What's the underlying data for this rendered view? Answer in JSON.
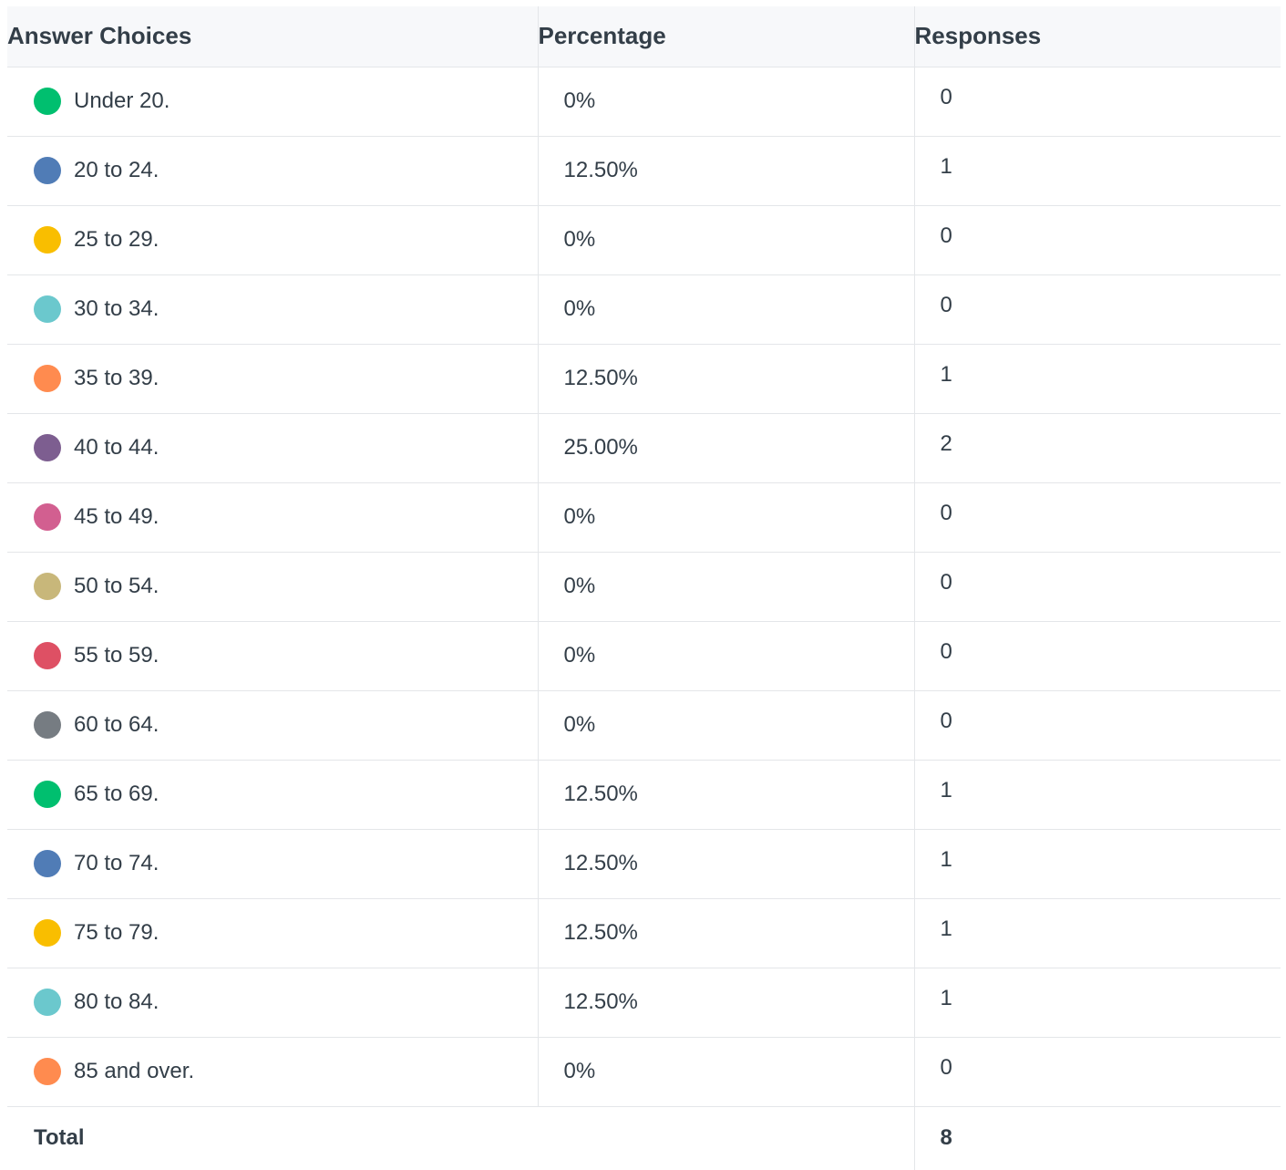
{
  "chart_data": {
    "type": "table",
    "columns": [
      "Answer Choices",
      "Percentage",
      "Responses"
    ],
    "rows": [
      {
        "label": "Under 20.",
        "percentage": "0%",
        "responses": "0",
        "color": "#00bf6f"
      },
      {
        "label": "20 to 24.",
        "percentage": "12.50%",
        "responses": "1",
        "color": "#507cb6"
      },
      {
        "label": "25 to 29.",
        "percentage": "0%",
        "responses": "0",
        "color": "#f9be00"
      },
      {
        "label": "30 to 34.",
        "percentage": "0%",
        "responses": "0",
        "color": "#6bc8cd"
      },
      {
        "label": "35 to 39.",
        "percentage": "12.50%",
        "responses": "1",
        "color": "#ff8b4f"
      },
      {
        "label": "40 to 44.",
        "percentage": "25.00%",
        "responses": "2",
        "color": "#7d5e90"
      },
      {
        "label": "45 to 49.",
        "percentage": "0%",
        "responses": "0",
        "color": "#d25f90"
      },
      {
        "label": "50 to 54.",
        "percentage": "0%",
        "responses": "0",
        "color": "#c8b77a"
      },
      {
        "label": "55 to 59.",
        "percentage": "0%",
        "responses": "0",
        "color": "#de5064"
      },
      {
        "label": "60 to 64.",
        "percentage": "0%",
        "responses": "0",
        "color": "#767c82"
      },
      {
        "label": "65 to 69.",
        "percentage": "12.50%",
        "responses": "1",
        "color": "#00bf6f"
      },
      {
        "label": "70 to 74.",
        "percentage": "12.50%",
        "responses": "1",
        "color": "#507cb6"
      },
      {
        "label": "75 to 79.",
        "percentage": "12.50%",
        "responses": "1",
        "color": "#f9be00"
      },
      {
        "label": "80 to 84.",
        "percentage": "12.50%",
        "responses": "1",
        "color": "#6bc8cd"
      },
      {
        "label": "85 and over.",
        "percentage": "0%",
        "responses": "0",
        "color": "#ff8b4f"
      }
    ],
    "total": {
      "label": "Total",
      "responses": "8"
    }
  }
}
